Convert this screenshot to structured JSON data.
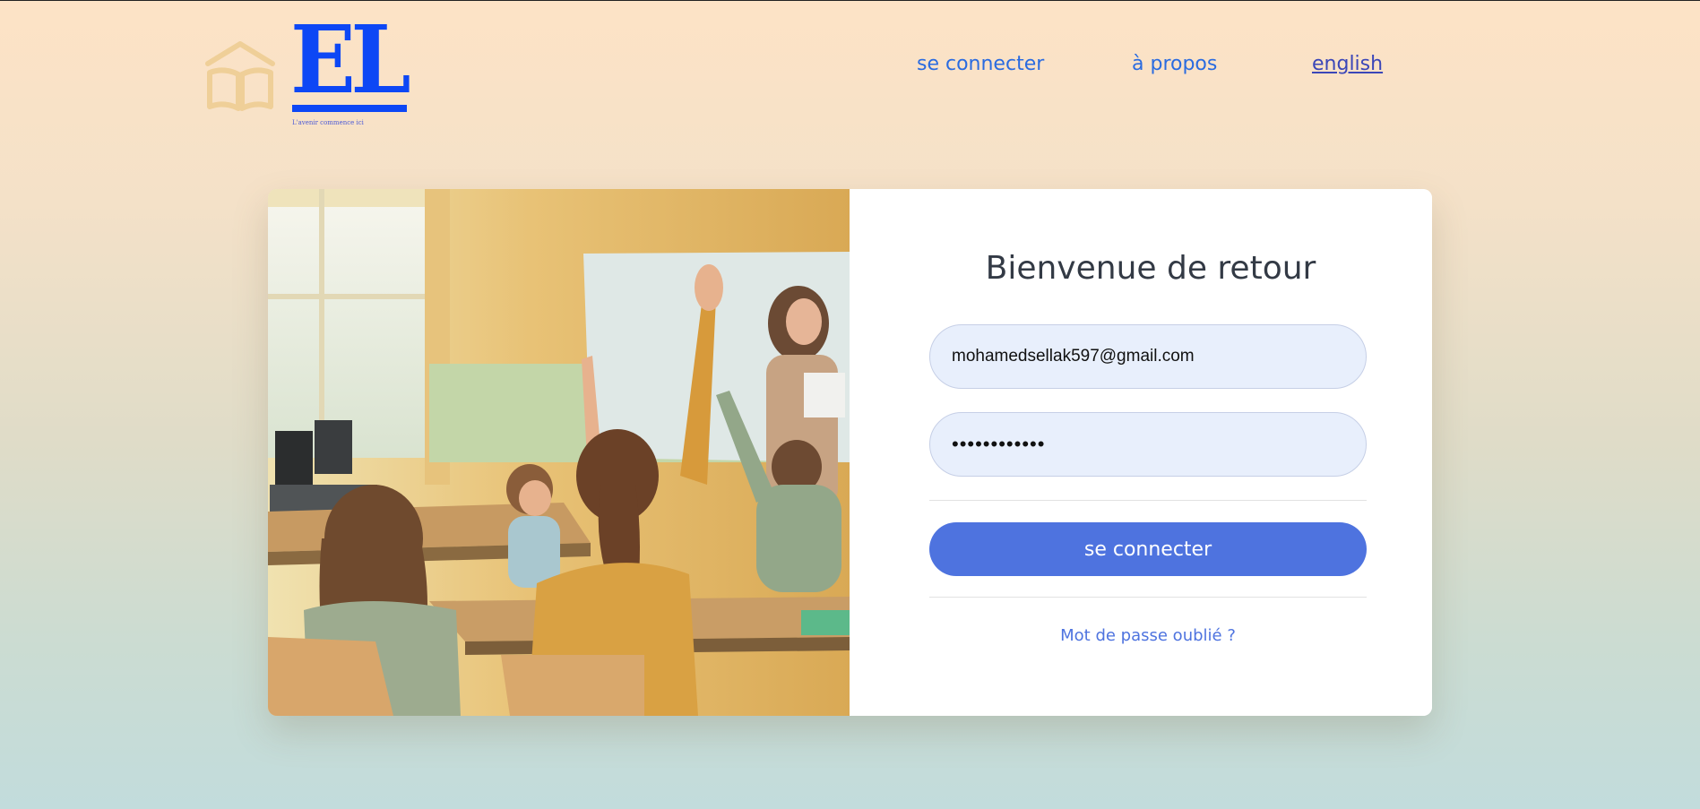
{
  "brand": {
    "logo_text": "EL",
    "tagline": "L'avenir commence ici",
    "logo_color": "#0d47f5",
    "icon": "open-book-house-icon"
  },
  "nav": {
    "login": "se connecter",
    "about": "à propos",
    "language": "english"
  },
  "hero_image": {
    "description_icon": "classroom-photo"
  },
  "login_form": {
    "title": "Bienvenue de retour",
    "email_value": "mohamedsellak597@gmail.com",
    "password_value": "••••••••••••",
    "submit_label": "se connecter",
    "forgot_label": "Mot de passe oublié ?"
  },
  "colors": {
    "primary": "#4e73df",
    "input_bg": "#e8effc",
    "link": "#2a6be0"
  }
}
